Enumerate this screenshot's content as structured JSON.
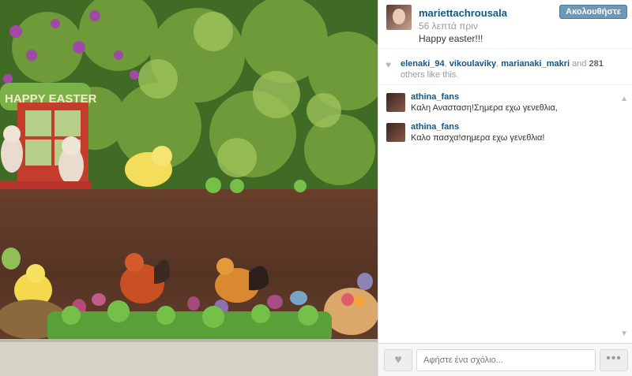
{
  "post": {
    "username": "mariettachrousala",
    "timestamp": "56 λεπτά πριν",
    "caption": "Happy easter!!!",
    "follow_label": "Ακολουθήστε"
  },
  "photo": {
    "sign_text": "HAPPY EASTER"
  },
  "likes": {
    "likers": [
      "elenaki_94",
      "vikoulaviky",
      "marianaki_makri"
    ],
    "sep1": ", ",
    "sep2": ", ",
    "and_text": " and ",
    "others_count": "281",
    "others_text": " others like this."
  },
  "comments": [
    {
      "user": "athina_fans",
      "text": "Καλη Ανασταση!Σημερα εχω γενεθλια,"
    },
    {
      "user": "athina_fans",
      "text": "Καλο πασχα!σημερα εχω γενεθλια!"
    }
  ],
  "footer": {
    "comment_placeholder": "Αφήστε ένα σχόλιο...",
    "more_label": "•••"
  },
  "icons": {
    "heart": "♥",
    "scroll_up": "▲",
    "scroll_down": "▼"
  }
}
